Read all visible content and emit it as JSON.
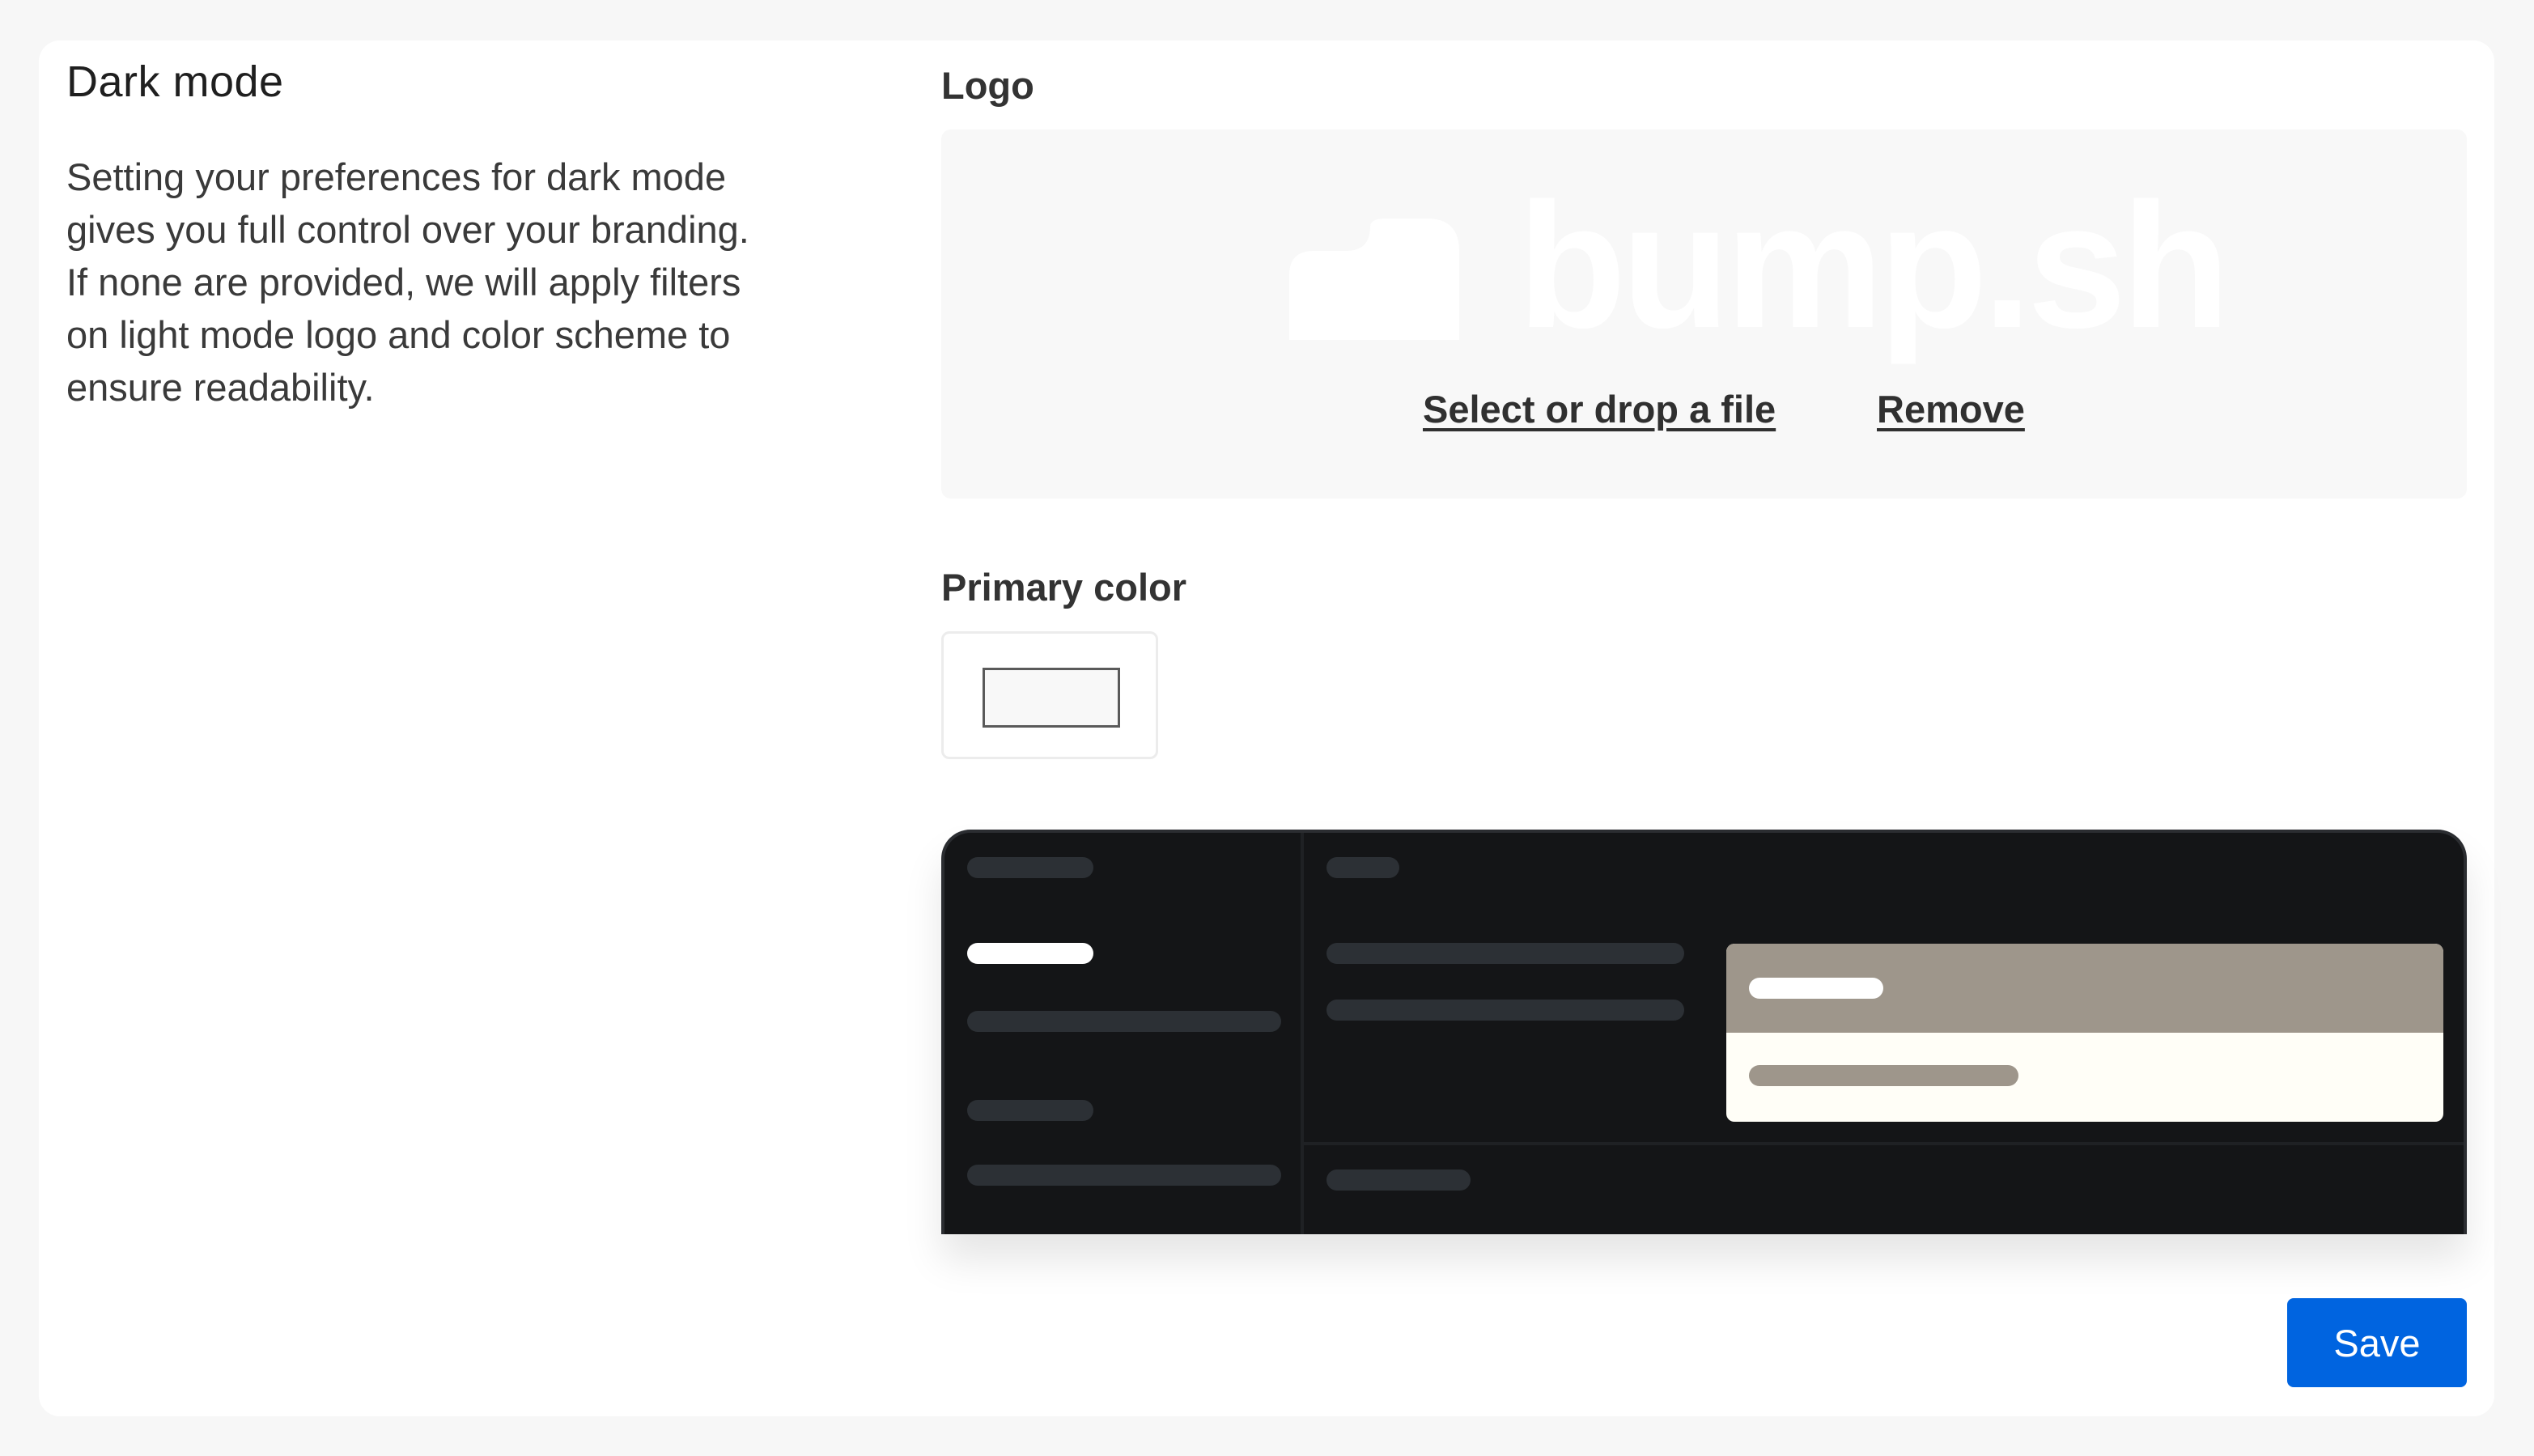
{
  "section": {
    "title": "Dark mode",
    "description": "Setting your preferences for dark mode gives you full control over your branding. If none are provided, we will apply filters on light mode logo and color scheme to ensure readability."
  },
  "logo": {
    "label": "Logo",
    "wordmark": "bump.sh",
    "select_link": "Select or drop a file",
    "remove_link": "Remove"
  },
  "primary_color": {
    "label": "Primary color",
    "value_hex": "#f8f8f8"
  },
  "preview": {
    "background": "#141517",
    "accent": "#9e968b",
    "panel_background": "#fffef7"
  },
  "save_button": {
    "label": "Save",
    "color": "#0064e0"
  }
}
